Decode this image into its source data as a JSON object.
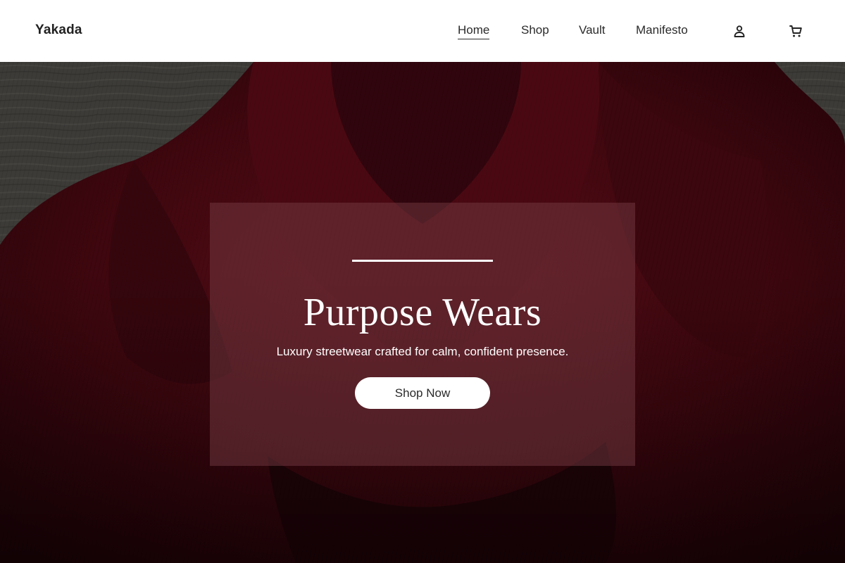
{
  "brand": {
    "name": "Yakada"
  },
  "nav": {
    "items": [
      {
        "label": "Home",
        "active": true
      },
      {
        "label": "Shop",
        "active": false
      },
      {
        "label": "Vault",
        "active": false
      },
      {
        "label": "Manifesto",
        "active": false
      }
    ]
  },
  "header_icons": {
    "account": "account-icon",
    "cart": "cart-icon"
  },
  "hero": {
    "title": "Purpose Wears",
    "subtitle": "Luxury streetwear crafted for calm, confident presence.",
    "cta_label": "Shop Now",
    "background": "red-knit-sweater-photo"
  },
  "colors": {
    "header_bg": "#ffffff",
    "text_dark": "#2a2a2a",
    "sweater_red": "#5a0c16",
    "card_overlay": "rgba(120, 60, 70, 0.48)",
    "button_bg": "#ffffff"
  }
}
